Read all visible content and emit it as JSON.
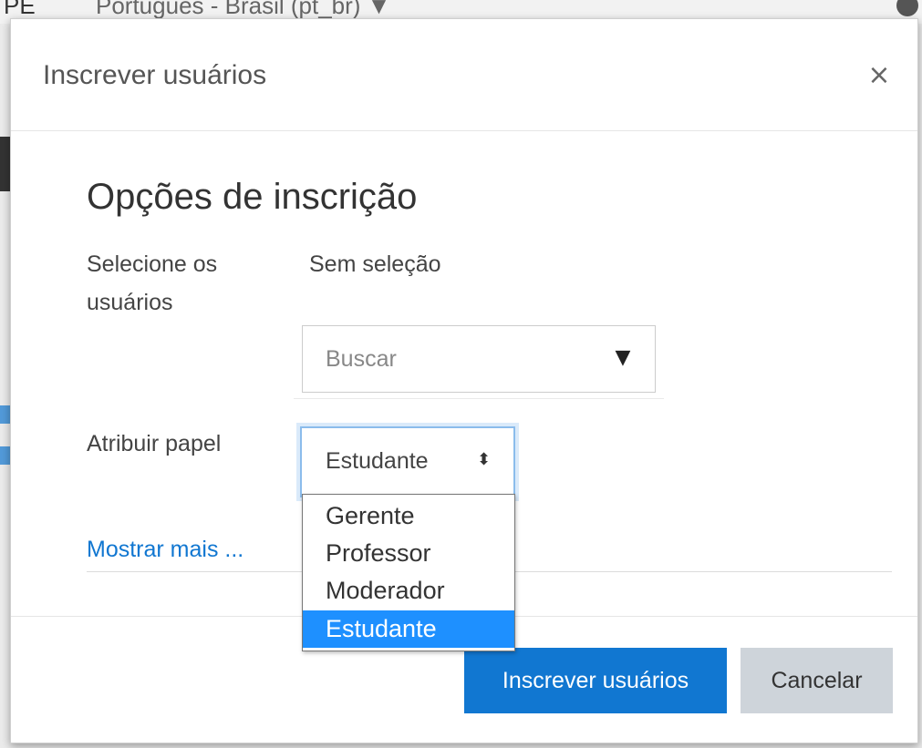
{
  "background": {
    "left_text": "PE",
    "language_selector": "Português - Brasil (pt_br) ▼"
  },
  "modal": {
    "title": "Inscrever usuários",
    "close_symbol": "×",
    "heading": "Opções de inscrição",
    "select_users": {
      "label": "Selecione os usuários",
      "current_value": "Sem seleção",
      "search_placeholder": "Buscar",
      "toggle_symbol": "▼"
    },
    "assign_role": {
      "label": "Atribuir papel",
      "selected_value": "Estudante",
      "arrows_symbol": "⬍",
      "options": [
        "Gerente",
        "Professor",
        "Moderador",
        "Estudante"
      ],
      "selected_index": 3
    },
    "show_more_link": "Mostrar mais ...",
    "buttons": {
      "submit": "Inscrever usuários",
      "cancel": "Cancelar"
    }
  },
  "colors": {
    "primary": "#1177d1",
    "secondary": "#ced4da",
    "dropdown_highlight": "#1e90ff",
    "focus_ring": "#8bbcec"
  }
}
